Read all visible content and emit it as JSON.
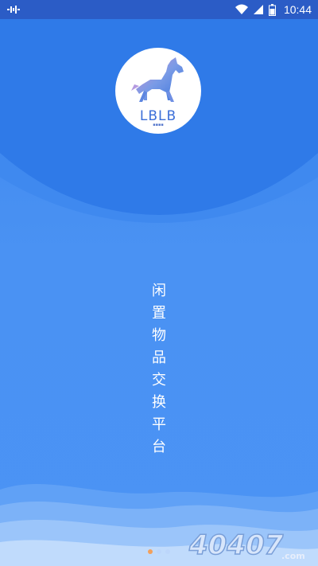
{
  "status_bar": {
    "time": "10:44",
    "icons": [
      "notification-icon",
      "wifi-icon",
      "signal-icon",
      "battery-icon"
    ]
  },
  "logo": {
    "text": "LBLB",
    "icon": "horse-logo-icon"
  },
  "slogan": {
    "chars": [
      "闲",
      "置",
      "物",
      "品",
      "交",
      "换",
      "平",
      "台"
    ]
  },
  "pager": {
    "count": 3,
    "active": 0
  },
  "watermark": {
    "text": "40407.com"
  },
  "colors": {
    "background": "#4b93f4",
    "status_bar": "#2b5cc6",
    "accent_dot": "#f2a05c",
    "logo_text": "#3c6fd8"
  }
}
